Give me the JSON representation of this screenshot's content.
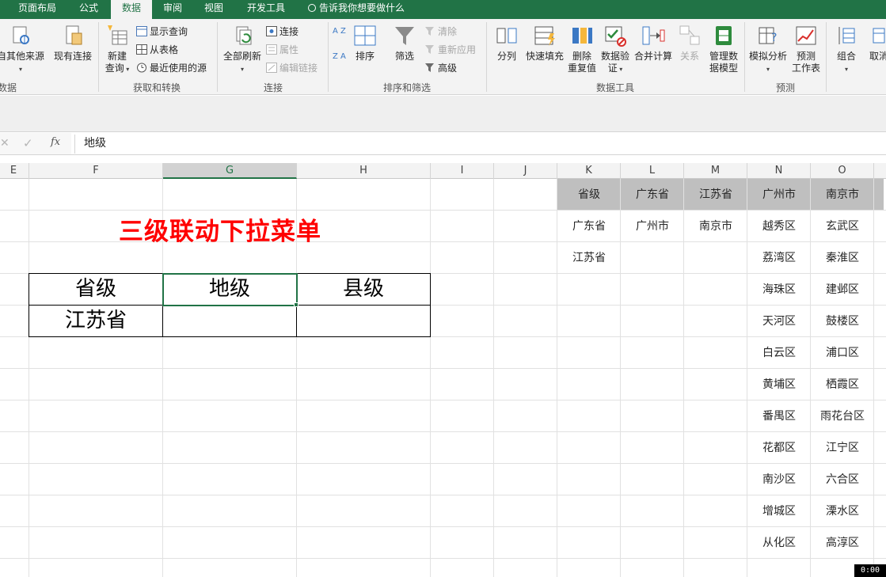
{
  "tabs": [
    {
      "label": "页面布局",
      "active": false
    },
    {
      "label": "公式",
      "active": false
    },
    {
      "label": "数据",
      "active": true
    },
    {
      "label": "审阅",
      "active": false
    },
    {
      "label": "视图",
      "active": false
    },
    {
      "label": "开发工具",
      "active": false
    }
  ],
  "tell_me": "告诉我你想要做什么",
  "ribbon": {
    "get_external": {
      "other_sources": "自其他来源",
      "existing": "现有连接",
      "group": "数据"
    },
    "get_transform": {
      "new_query_1": "新建",
      "new_query_2": "查询",
      "show_queries": "显示查询",
      "from_table": "从表格",
      "recent_sources": "最近使用的源",
      "group": "获取和转换"
    },
    "connections": {
      "refresh_all": "全部刷新",
      "connections": "连接",
      "properties": "属性",
      "edit_links": "编辑链接",
      "group": "连接"
    },
    "sort_filter": {
      "sort": "排序",
      "filter": "筛选",
      "clear": "清除",
      "reapply": "重新应用",
      "advanced": "高级",
      "group": "排序和筛选",
      "az": "A Z",
      "za": "Z A"
    },
    "data_tools": {
      "text_to_columns": "分列",
      "flash_fill": "快速填充",
      "remove_dup_1": "删除",
      "remove_dup_2": "重复值",
      "validation_1": "数据验",
      "validation_2": "证",
      "consolidate": "合并计算",
      "relationships": "关系",
      "manage_model_1": "管理数",
      "manage_model_2": "据模型",
      "group": "数据工具"
    },
    "forecast": {
      "what_if": "模拟分析",
      "forecast_1": "预测",
      "forecast_2": "工作表",
      "group": "预测"
    },
    "outline": {
      "group_btn": "组合",
      "ungroup": "取消"
    }
  },
  "formula_bar": {
    "value": "地级",
    "fx": "fx",
    "cancel": "✕",
    "enter": "✓"
  },
  "columns": [
    "E",
    "F",
    "G",
    "H",
    "I",
    "J",
    "K",
    "L",
    "M",
    "N",
    "O"
  ],
  "selected_column": "G",
  "sheet": {
    "title": "三级联动下拉菜单",
    "headers": [
      "省级",
      "地级",
      "县级"
    ],
    "row2": [
      "江苏省",
      "",
      ""
    ]
  },
  "lookup": {
    "headers": [
      "省级",
      "广东省",
      "江苏省",
      "广州市",
      "南京市"
    ],
    "provinces": [
      "广东省",
      "江苏省"
    ],
    "guangdong_cities": [
      "广州市"
    ],
    "jiangsu_cities": [
      "南京市"
    ],
    "guangzhou_districts": [
      "越秀区",
      "荔湾区",
      "海珠区",
      "天河区",
      "白云区",
      "黄埔区",
      "番禺区",
      "花都区",
      "南沙区",
      "增城区",
      "从化区"
    ],
    "nanjing_districts": [
      "玄武区",
      "秦淮区",
      "建邺区",
      "鼓楼区",
      "浦口区",
      "栖霞区",
      "雨花台区",
      "江宁区",
      "六合区",
      "溧水区",
      "高淳区"
    ]
  },
  "timer": "0:00",
  "colors": {
    "excel_green": "#217346",
    "title_red": "#ff0000",
    "header_gray": "#bfbfbf"
  }
}
